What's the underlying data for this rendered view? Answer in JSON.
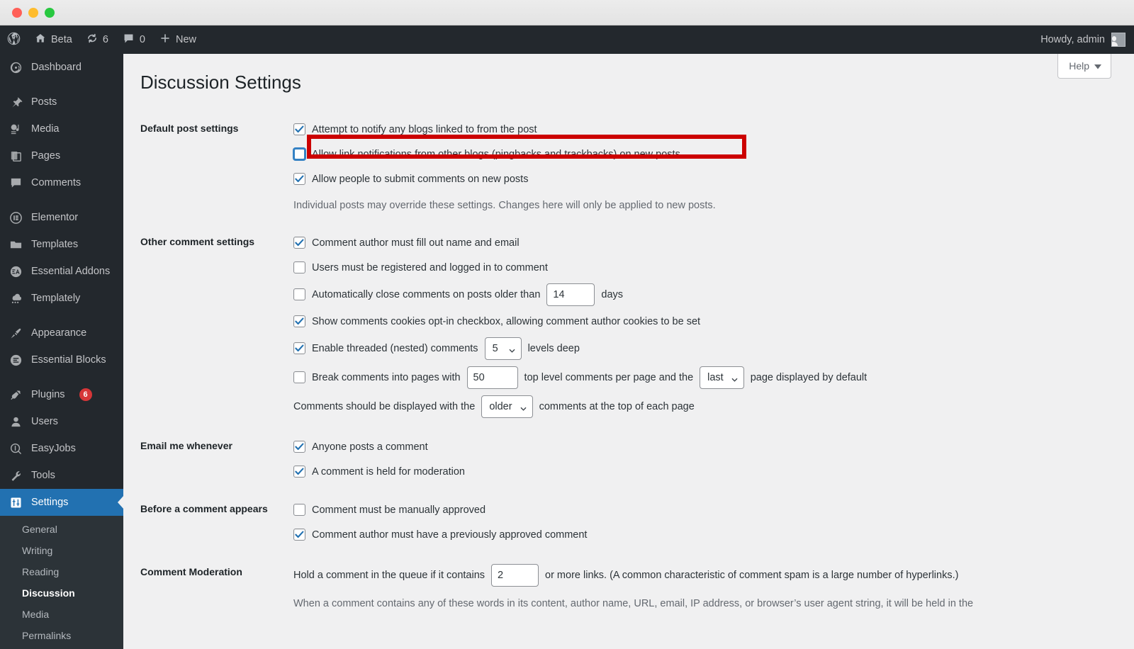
{
  "window": {
    "traffic_lights": [
      "close",
      "minimize",
      "zoom"
    ],
    "colors": {
      "close": "#ff5f57",
      "minimize": "#febc2e",
      "zoom": "#28c840"
    }
  },
  "adminbar": {
    "wp_logo": "wordpress-logo-icon",
    "site_name": "Beta",
    "site_icon": "home-icon",
    "updates_icon": "updates-icon",
    "updates_count": "6",
    "comments_icon": "comment-bubble-icon",
    "comments_count": "0",
    "new_icon": "plus-icon",
    "new_label": "New",
    "howdy": "Howdy, admin",
    "avatar": "user-avatar-icon"
  },
  "sidebar": {
    "items": [
      {
        "label": "Dashboard",
        "icon": "dashboard-icon",
        "current": false
      },
      {
        "label": "Posts",
        "icon": "pin-icon",
        "current": false
      },
      {
        "label": "Media",
        "icon": "media-icon",
        "current": false
      },
      {
        "label": "Pages",
        "icon": "pages-icon",
        "current": false
      },
      {
        "label": "Comments",
        "icon": "comment-icon",
        "current": false
      },
      {
        "label": "Elementor",
        "icon": "elementor-icon",
        "current": false
      },
      {
        "label": "Templates",
        "icon": "folder-icon",
        "current": false
      },
      {
        "label": "Essential Addons",
        "icon": "essential-addons-icon",
        "current": false
      },
      {
        "label": "Templately",
        "icon": "templately-icon",
        "current": false
      },
      {
        "label": "Appearance",
        "icon": "paintbrush-icon",
        "current": false
      },
      {
        "label": "Essential Blocks",
        "icon": "essential-blocks-icon",
        "current": false
      },
      {
        "label": "Plugins",
        "icon": "plug-icon",
        "current": false,
        "badge": "6"
      },
      {
        "label": "Users",
        "icon": "user-icon",
        "current": false
      },
      {
        "label": "EasyJobs",
        "icon": "easyjobs-icon",
        "current": false
      },
      {
        "label": "Tools",
        "icon": "wrench-icon",
        "current": false
      },
      {
        "label": "Settings",
        "icon": "settings-sliders-icon",
        "current": true
      }
    ],
    "submenu": [
      {
        "label": "General",
        "current": false
      },
      {
        "label": "Writing",
        "current": false
      },
      {
        "label": "Reading",
        "current": false
      },
      {
        "label": "Discussion",
        "current": true
      },
      {
        "label": "Media",
        "current": false
      },
      {
        "label": "Permalinks",
        "current": false
      }
    ]
  },
  "page": {
    "title": "Discussion Settings",
    "help_label": "Help",
    "help_icon": "chevron-down-icon"
  },
  "sections": {
    "default_post": {
      "heading": "Default post settings",
      "options": [
        {
          "label": "Attempt to notify any blogs linked to from the post",
          "checked": true,
          "focused": false
        },
        {
          "label": "Allow link notifications from other blogs (pingbacks and trackbacks) on new posts",
          "checked": false,
          "focused": true
        },
        {
          "label": "Allow people to submit comments on new posts",
          "checked": true,
          "focused": false
        }
      ],
      "description": "Individual posts may override these settings. Changes here will only be applied to new posts."
    },
    "other_comment": {
      "heading": "Other comment settings",
      "opt_name_email": {
        "label": "Comment author must fill out name and email",
        "checked": true
      },
      "opt_registered": {
        "label": "Users must be registered and logged in to comment",
        "checked": false
      },
      "opt_autoclose": {
        "label": "Automatically close comments on posts older than",
        "checked": false,
        "value": "14",
        "suffix": "days"
      },
      "opt_cookies": {
        "label": "Show comments cookies opt-in checkbox, allowing comment author cookies to be set",
        "checked": true
      },
      "opt_threaded": {
        "label": "Enable threaded (nested) comments",
        "checked": true,
        "levels": "5",
        "suffix": "levels deep"
      },
      "opt_paged": {
        "label": "Break comments into pages with",
        "checked": false,
        "per_page": "50",
        "middle_text": "top level comments per page and the",
        "default_page": "last",
        "suffix": "page displayed by default"
      },
      "opt_order": {
        "prefix": "Comments should be displayed with the",
        "order": "older",
        "suffix": "comments at the top of each page"
      }
    },
    "email_me": {
      "heading": "Email me whenever",
      "options": [
        {
          "label": "Anyone posts a comment",
          "checked": true
        },
        {
          "label": "A comment is held for moderation",
          "checked": true
        }
      ]
    },
    "before_appears": {
      "heading": "Before a comment appears",
      "options": [
        {
          "label": "Comment must be manually approved",
          "checked": false
        },
        {
          "label": "Comment author must have a previously approved comment",
          "checked": true
        }
      ]
    },
    "comment_moderation": {
      "heading": "Comment Moderation",
      "hold_prefix": "Hold a comment in the queue if it contains",
      "hold_value": "2",
      "hold_suffix": "or more links. (A common characteristic of comment spam is a large number of hyperlinks.)",
      "words_note": "When a comment contains any of these words in its content, author name, URL, email, IP address, or browser’s user agent string, it will be held in the"
    }
  },
  "annotation": {
    "highlight_color": "#cc0000",
    "target": "allow-link-notifications-checkbox-row"
  }
}
